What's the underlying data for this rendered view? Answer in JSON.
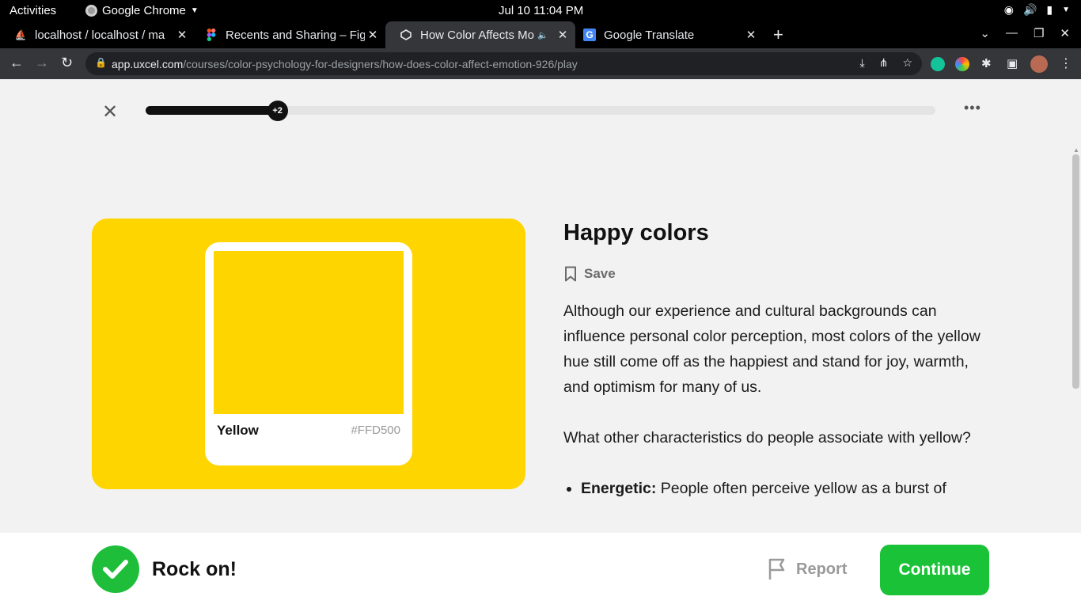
{
  "system_bar": {
    "activities": "Activities",
    "app_name": "Google Chrome",
    "clock": "Jul 10  11:04 PM"
  },
  "tabs": [
    {
      "title": "localhost / localhost / ma",
      "favicon": "phpmyadmin-icon",
      "active": false
    },
    {
      "title": "Recents and Sharing – Fig",
      "favicon": "figma-icon",
      "active": false
    },
    {
      "title": "How Color Affects Mo",
      "favicon": "uxcel-icon",
      "active": true,
      "audio": true
    },
    {
      "title": "Google Translate",
      "favicon": "google-translate-icon",
      "active": false
    }
  ],
  "address_bar": {
    "host": "app.uxcel.com",
    "path": "/courses/color-psychology-for-designers/how-does-color-affect-emotion-926/play"
  },
  "lesson": {
    "progress_percent": 16.7,
    "progress_badge": "+2",
    "title": "Happy colors",
    "save_label": "Save",
    "paragraph_1": "Although our experience and cultural backgrounds can influence personal color perception, most colors of the yellow hue still come off as the happiest and stand for joy, warmth, and optimism for many of us.",
    "paragraph_2": "What other characteristics do people associate with yellow?",
    "bullets": [
      {
        "term": "Energetic:",
        "text": " People often perceive yellow as a burst of"
      }
    ]
  },
  "swatch": {
    "name": "Yellow",
    "hex": "#FFD500",
    "card_color": "#FFD500"
  },
  "feedback": {
    "message": "Rock on!",
    "report_label": "Report",
    "continue_label": "Continue"
  },
  "colors": {
    "accent_green": "#19C236",
    "yellow": "#FFD500"
  }
}
